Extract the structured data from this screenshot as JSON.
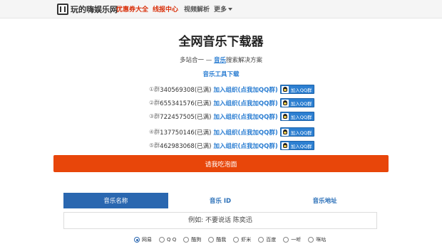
{
  "navbar": {
    "brand": "玩的嗨娱乐网",
    "items": [
      "优惠券大全",
      "线报中心",
      "视频解析",
      "更多"
    ]
  },
  "header": {
    "title": "全网音乐下载器",
    "subtitle_prefix": "多站合一 — ",
    "subtitle_link": "音乐",
    "subtitle_suffix": "搜索解决方案",
    "tools_link": "音乐工具下载"
  },
  "groups": [
    {
      "index": "①群",
      "number": "340569308(已满)",
      "link": "加入组织(点我加QQ群)",
      "qq_label": "加入QQ群"
    },
    {
      "index": "②群",
      "number": "655341576(已满)",
      "link": "加入组织(点我加QQ群)",
      "qq_label": "加入QQ群"
    },
    {
      "index": "③群",
      "number": "722457505(已满)",
      "link": "加入组织(点我加QQ群)",
      "qq_label": "加入QQ群"
    },
    {
      "index": "④群",
      "number": "137750146(已满)",
      "link": "加入组织(点我加QQ群)",
      "qq_label": "加入QQ群"
    },
    {
      "index": "⑤群",
      "number": "462983068(已满)",
      "link": "加入组织(点我加QQ群)",
      "qq_label": "加入QQ群"
    }
  ],
  "eat_button": "请我吃泡面",
  "search": {
    "tabs": [
      "音乐名称",
      "音乐 ID",
      "音乐地址"
    ],
    "active_tab": 0,
    "placeholder": "例如: 不要说话 陈奕迅"
  },
  "sources": {
    "options": [
      "网易",
      "Q Q",
      "酷狗",
      "酷我",
      "虾米",
      "百度",
      "一听",
      "咪咕"
    ],
    "selected": 0
  },
  "colors": {
    "accent": "#2a67b0",
    "link": "#2a7dd2",
    "button": "#e8460a",
    "nav_red": "#d9300a"
  }
}
